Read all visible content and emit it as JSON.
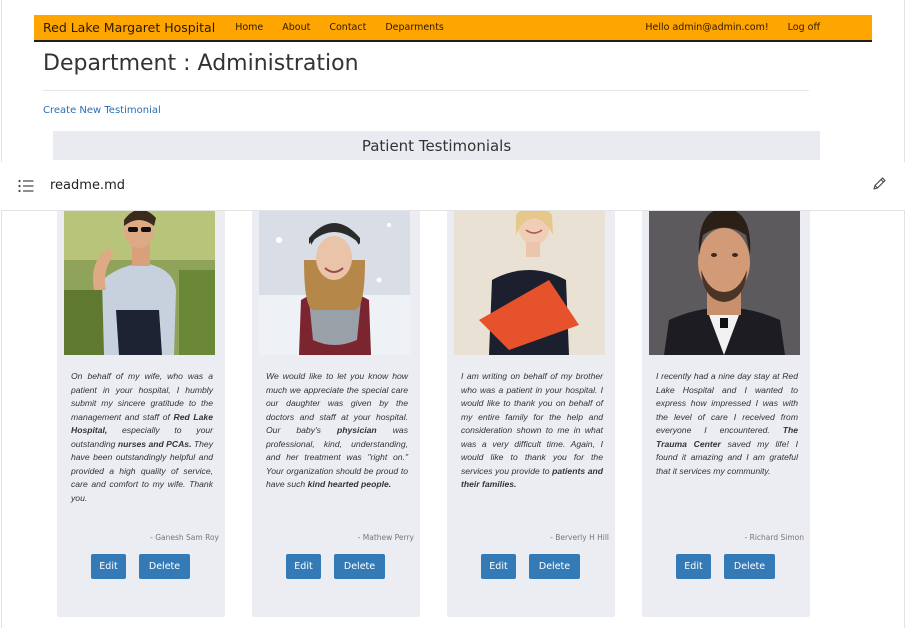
{
  "navbar": {
    "brand": "Red Lake Margaret Hospital",
    "links": [
      "Home",
      "About",
      "Contact",
      "Deparments"
    ],
    "greeting": "Hello admin@admin.com!",
    "logoff": "Log off"
  },
  "page": {
    "title": "Department : Administration",
    "create_link": "Create New Testimonial",
    "section_title": "Patient Testimonials"
  },
  "readme": {
    "filename": "readme.md",
    "icons": [
      "list-icon",
      "pencil-icon"
    ]
  },
  "cards": [
    {
      "quote_html": "On behalf of my wife, who was a patient in your hospital, I humbly submit my sincere gratitude to the management and staff of <b>Red Lake Hospital,</b> especially to your outstanding <b>nurses and PCAs.</b> They have been outstandingly helpful and provided a high quality of service, care and comfort to my wife. Thank you.",
      "author": "- Ganesh Sam Roy",
      "edit": "Edit",
      "delete": "Delete"
    },
    {
      "quote_html": "We would like to let you know how much we appreciate the special care our daughter was given by the doctors and staff at your hospital. Our baby's <b>physician</b> was professional, kind, understanding, and her treatment was \"right on.\" Your organization should be proud to have such <b>kind hearted people.</b>",
      "author": "- Mathew Perry",
      "edit": "Edit",
      "delete": "Delete"
    },
    {
      "quote_html": "I am writing on behalf of my brother who was a patient in your hospital. I would like to thank you on behalf of my entire family for the help and consideration shown to me in what was a very difficult time. Again, I would like to thank you for the services you provide to <b>patients and their families.</b>",
      "author": "- Berverly H Hill",
      "edit": "Edit",
      "delete": "Delete"
    },
    {
      "quote_html": "I recently had a nine day stay at Red Lake Hospital and I wanted to express how impressed I was with the level of care I received from everyone I encountered. <b>The Trauma Center</b> saved my life! I found it amazing and I am grateful that it services my community.",
      "author": "- Richard Simon",
      "edit": "Edit",
      "delete": "Delete"
    }
  ],
  "colors": {
    "navbar_bg": "#ffa500",
    "button_bg": "#337ab7",
    "card_bg": "#ebedf2",
    "link": "#2a6fb0"
  }
}
